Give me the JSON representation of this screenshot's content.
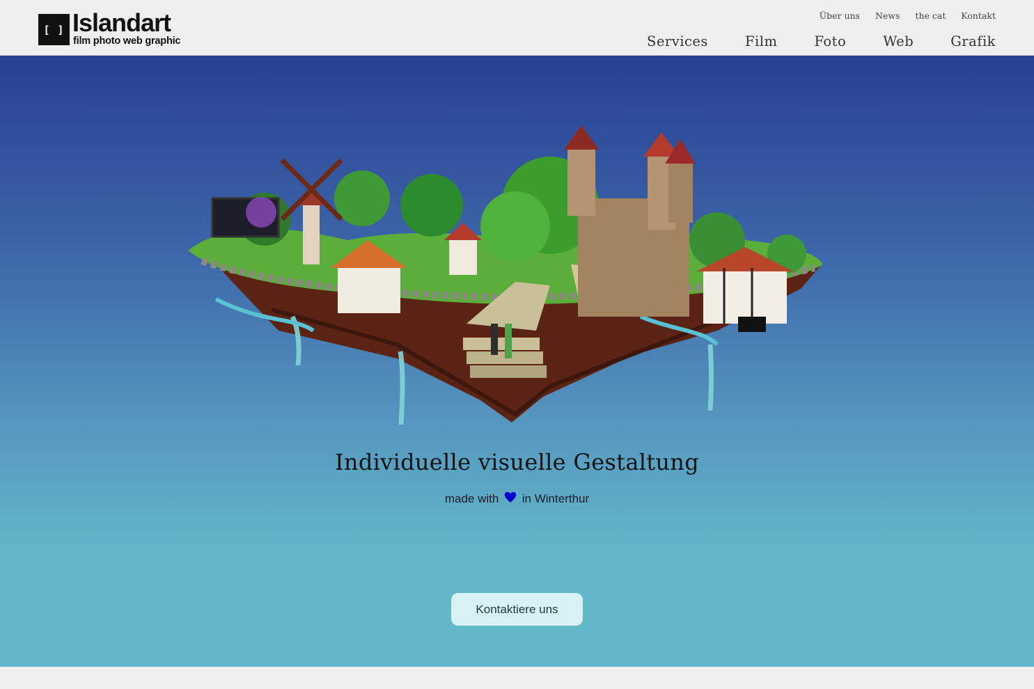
{
  "brand": {
    "mark": "[ ]",
    "name": "Islandart",
    "tagline": "film photo web graphic"
  },
  "top_links": [
    "Über uns",
    "News",
    "the cat",
    "Kontakt"
  ],
  "main_nav": [
    "Services",
    "Film",
    "Foto",
    "Web",
    "Grafik"
  ],
  "hero": {
    "title": "Individuelle visuelle Gestaltung",
    "sub_before": "made with",
    "sub_icon": "heart-icon",
    "sub_after": "in Winterthur",
    "cta_label": "Kontaktiere uns",
    "illustration": "floating-island-illustration"
  },
  "colors": {
    "hero_top": "#283f92",
    "hero_bottom": "#62b8c9",
    "heart": "#0000cc",
    "cta_bg": "#d8f1f4",
    "page_bg": "#efefef"
  }
}
